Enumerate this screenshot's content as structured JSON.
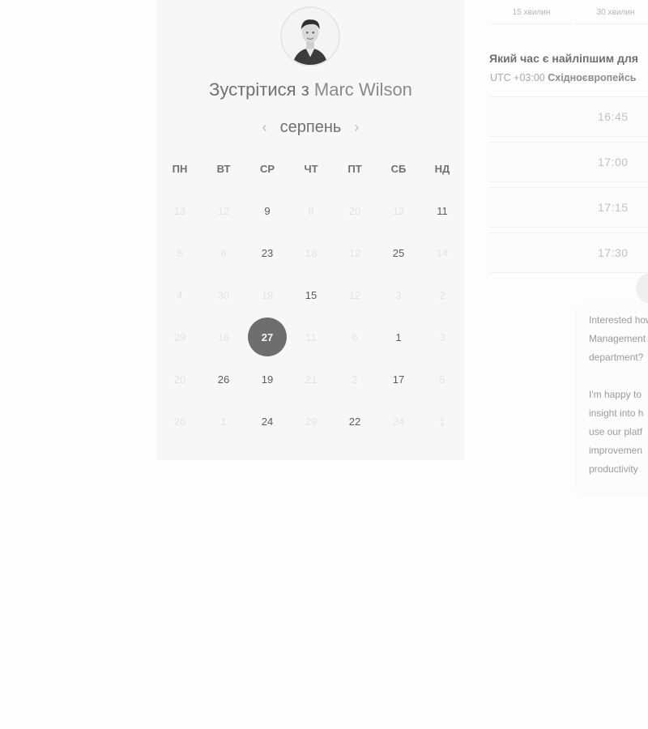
{
  "scheduler": {
    "title_prefix": "Зустрітися з",
    "host_name": "Marc Wilson",
    "month": "серпень",
    "prev_icon": "‹",
    "next_icon": "›",
    "weekdays": [
      "ПН",
      "ВТ",
      "СР",
      "ЧТ",
      "ПТ",
      "СБ",
      "НД"
    ],
    "days": [
      {
        "label": "13",
        "active": false
      },
      {
        "label": "12",
        "active": false
      },
      {
        "label": "9",
        "active": true
      },
      {
        "label": "8",
        "active": false
      },
      {
        "label": "20",
        "active": false
      },
      {
        "label": "13",
        "active": false
      },
      {
        "label": "11",
        "active": true
      },
      {
        "label": "8",
        "active": false
      },
      {
        "label": "6",
        "active": false
      },
      {
        "label": "23",
        "active": true
      },
      {
        "label": "18",
        "active": false
      },
      {
        "label": "12",
        "active": false
      },
      {
        "label": "25",
        "active": true
      },
      {
        "label": "14",
        "active": false
      },
      {
        "label": "4",
        "active": false
      },
      {
        "label": "30",
        "active": false
      },
      {
        "label": "19",
        "active": false
      },
      {
        "label": "15",
        "active": true
      },
      {
        "label": "12",
        "active": false
      },
      {
        "label": "3",
        "active": false
      },
      {
        "label": "2",
        "active": false
      },
      {
        "label": "29",
        "active": false
      },
      {
        "label": "16",
        "active": false
      },
      {
        "label": "27",
        "active": true,
        "selected": true
      },
      {
        "label": "11",
        "active": false
      },
      {
        "label": "6",
        "active": false
      },
      {
        "label": "1",
        "active": true
      },
      {
        "label": "3",
        "active": false
      },
      {
        "label": "20",
        "active": false
      },
      {
        "label": "26",
        "active": true
      },
      {
        "label": "19",
        "active": true
      },
      {
        "label": "21",
        "active": false
      },
      {
        "label": "2",
        "active": false
      },
      {
        "label": "17",
        "active": true
      },
      {
        "label": "5",
        "active": false
      },
      {
        "label": "26",
        "active": false
      },
      {
        "label": "1",
        "active": false
      },
      {
        "label": "24",
        "active": true
      },
      {
        "label": "29",
        "active": false
      },
      {
        "label": "22",
        "active": true
      },
      {
        "label": "24",
        "active": false
      },
      {
        "label": "1",
        "active": false
      }
    ]
  },
  "times": {
    "durations": [
      "15 хвилин",
      "30 хвилин"
    ],
    "heading": "Який час є найліпшим для",
    "tz_offset": "UTC +03:00",
    "tz_name": "Східноєвропейсь",
    "slots": [
      "16:45",
      "17:00",
      "17:15",
      "17:30"
    ]
  },
  "chat": {
    "message": "Interested how\nManagement\ndepartment?\n\nI'm happy to\ninsight into h\nuse our platf\nimprovemen\nproductivity"
  },
  "colors": {
    "panel_bg": "#f7f7f7",
    "selected_day": "#6e6e6e",
    "page_bg": "#fdfdfd"
  }
}
